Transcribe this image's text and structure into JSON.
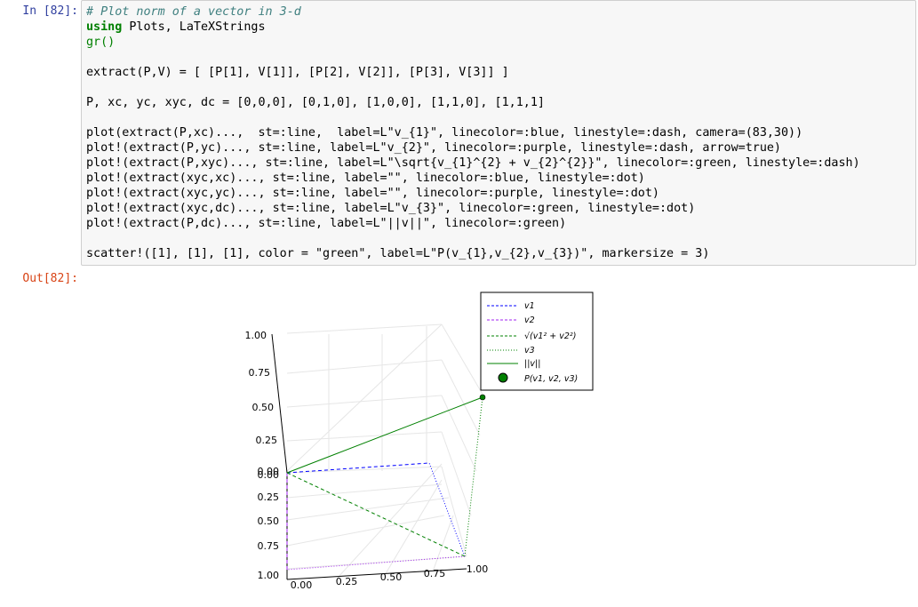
{
  "prompts": {
    "in": "In [82]:",
    "out": "Out[82]:"
  },
  "code": {
    "comment": "# Plot norm of a vector in 3-d",
    "using_kw": "using",
    "using_rest": " Plots, LaTeXStrings",
    "gr": "gr()",
    "extract": "extract(P,V) = [ [P[1], V[1]], [P[2], V[2]], [P[3], V[3]] ]",
    "assign": "P, xc, yc, xyc, dc = [0,0,0], [0,1,0], [1,0,0], [1,1,0], [1,1,1]",
    "plot_lines": [
      "plot(extract(P,xc)...,  st=:line,  label=L\"v_{1}\", linecolor=:blue, linestyle=:dash, camera=(83,30))",
      "plot!(extract(P,yc)..., st=:line, label=L\"v_{2}\", linecolor=:purple, linestyle=:dash, arrow=true)",
      "plot!(extract(P,xyc)..., st=:line, label=L\"\\sqrt{v_{1}^{2} + v_{2}^{2}}\", linecolor=:green, linestyle=:dash)",
      "plot!(extract(xyc,xc)..., st=:line, label=\"\", linecolor=:blue, linestyle=:dot)",
      "plot!(extract(xyc,yc)..., st=:line, label=\"\", linecolor=:purple, linestyle=:dot)",
      "plot!(extract(xyc,dc)..., st=:line, label=L\"v_{3}\", linecolor=:green, linestyle=:dot)",
      "plot!(extract(P,dc)..., st=:line, label=L\"||v||\", linecolor=:green)"
    ],
    "scatter": "scatter!([1], [1], [1], color = \"green\", label=L\"P(v_{1},v_{2},v_{3})\", markersize = 3)"
  },
  "chart_data": {
    "type": "line",
    "projection": "3d",
    "camera": [
      83,
      30
    ],
    "axis_ticks": {
      "vertical": [
        "1.00",
        "0.75",
        "0.50",
        "0.25",
        "0.00",
        "0.00",
        "0.25",
        "0.50",
        "0.75",
        "1.00"
      ],
      "horizontal": [
        "0.00",
        "0.25",
        "0.50",
        "0.75",
        "1.00"
      ]
    },
    "series": [
      {
        "name": "v1",
        "from": [
          0,
          0,
          0
        ],
        "to": [
          0,
          1,
          0
        ],
        "color": "#0000ff",
        "style": "dash"
      },
      {
        "name": "v2",
        "from": [
          0,
          0,
          0
        ],
        "to": [
          1,
          0,
          0
        ],
        "color": "#a020f0",
        "style": "dash"
      },
      {
        "name": "sqrt(v1^2 + v2^2)",
        "from": [
          0,
          0,
          0
        ],
        "to": [
          1,
          1,
          0
        ],
        "color": "#008000",
        "style": "dash"
      },
      {
        "name": "",
        "from": [
          1,
          1,
          0
        ],
        "to": [
          0,
          1,
          0
        ],
        "color": "#0000ff",
        "style": "dot"
      },
      {
        "name": "",
        "from": [
          1,
          1,
          0
        ],
        "to": [
          1,
          0,
          0
        ],
        "color": "#a020f0",
        "style": "dot"
      },
      {
        "name": "v3",
        "from": [
          1,
          1,
          0
        ],
        "to": [
          1,
          1,
          1
        ],
        "color": "#008000",
        "style": "dot"
      },
      {
        "name": "||v||",
        "from": [
          0,
          0,
          0
        ],
        "to": [
          1,
          1,
          1
        ],
        "color": "#008000",
        "style": "solid"
      }
    ],
    "points": [
      {
        "name": "P(v1,v2,v3)",
        "at": [
          1,
          1,
          1
        ],
        "color": "#008000"
      }
    ],
    "legend": {
      "placement": "top-right",
      "entries": [
        "v1",
        "v2",
        "√(v1² + v2²)",
        "v3",
        "||v||",
        "P(v1, v2, v3)"
      ]
    },
    "grid": true
  }
}
